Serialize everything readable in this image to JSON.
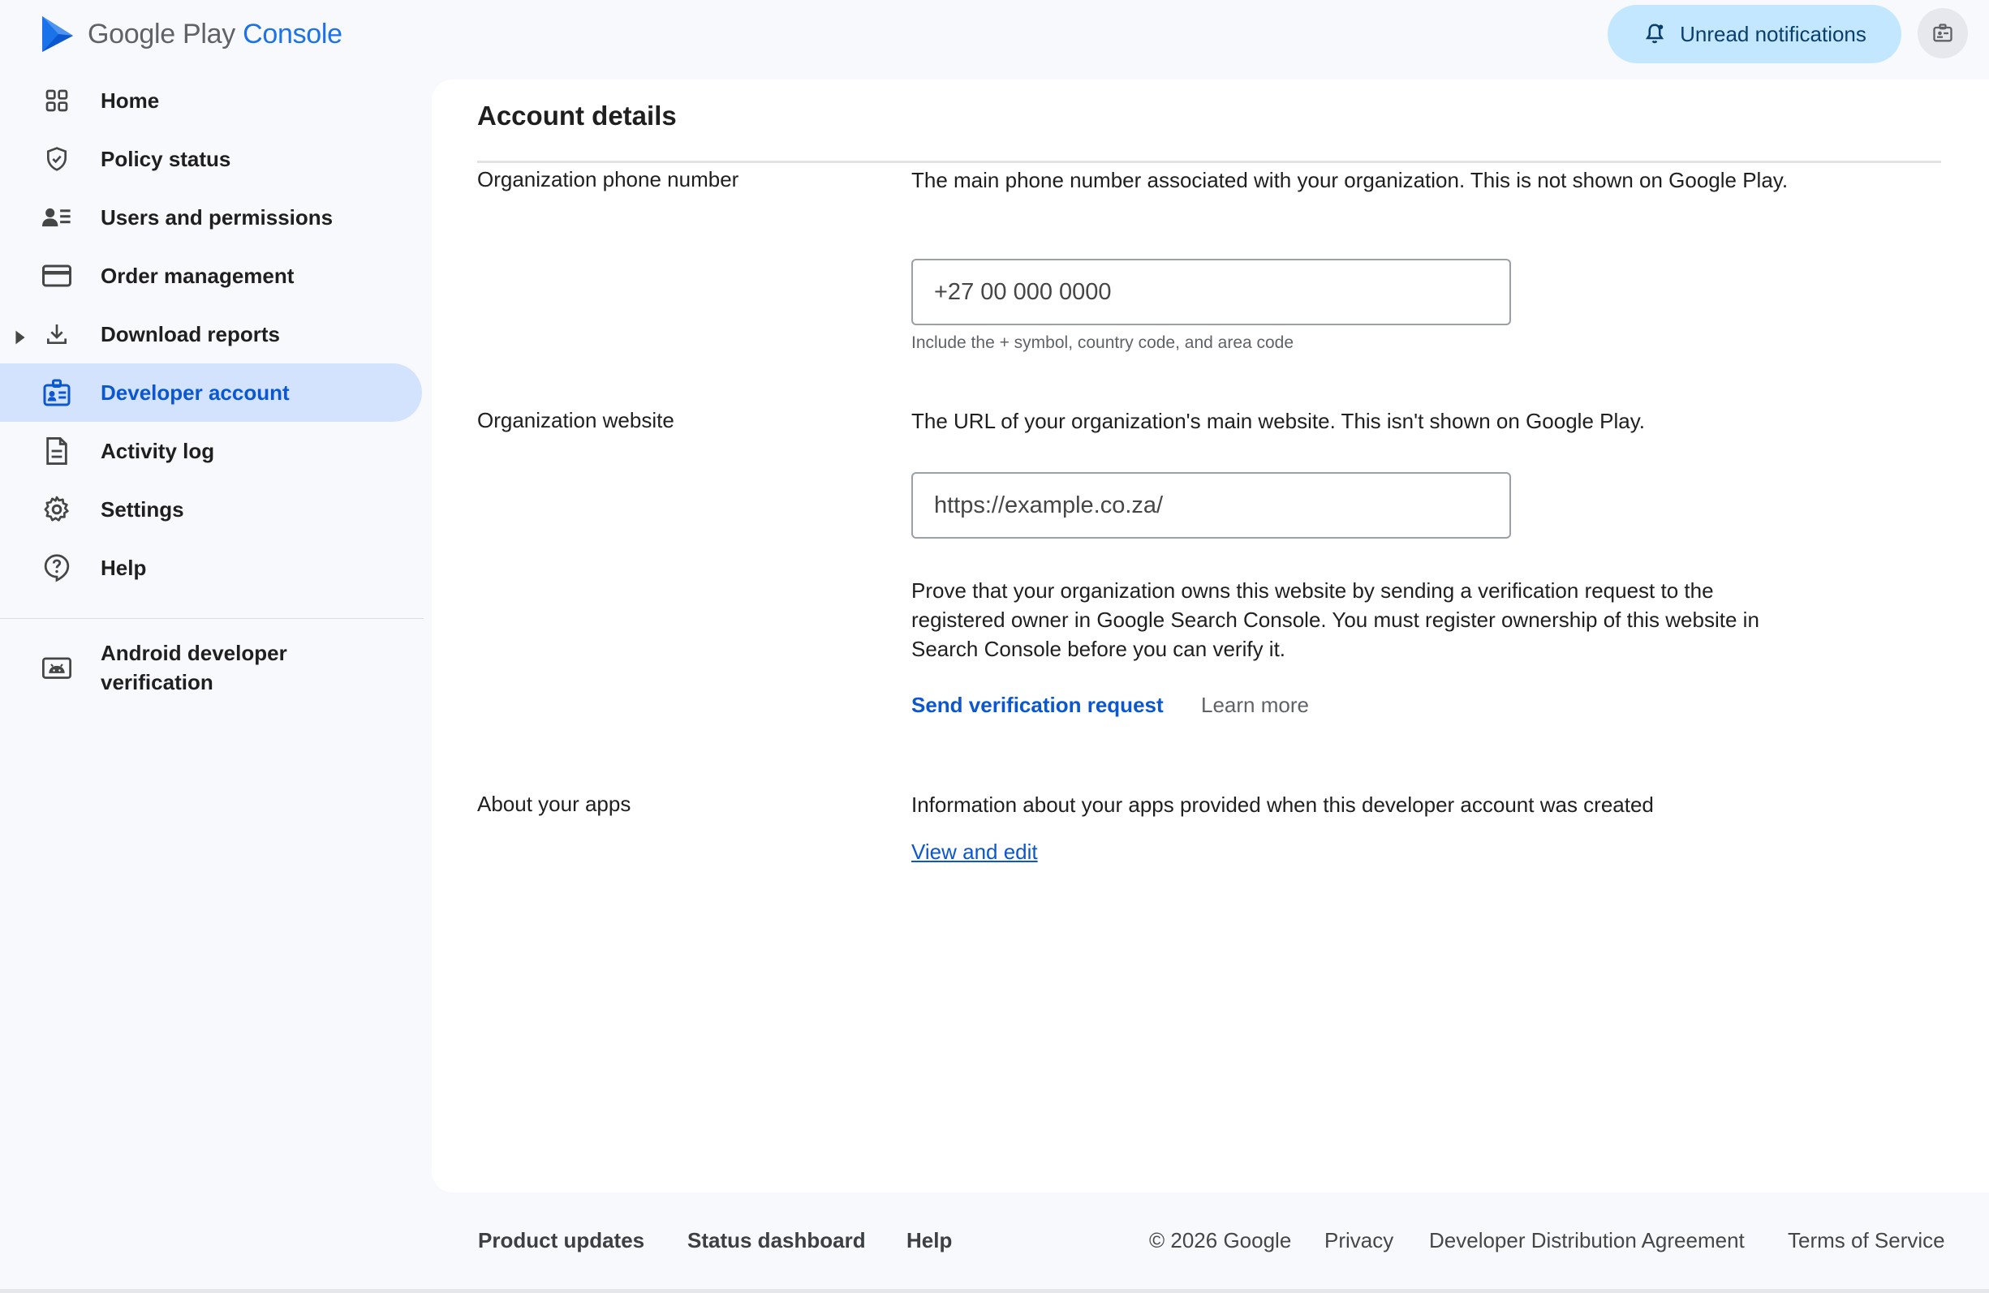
{
  "app": {
    "logo_name": "Google Play",
    "logo_accent": "Console",
    "notifications_label": "Unread notifications"
  },
  "sidebar": {
    "items": [
      {
        "label": "Home",
        "icon": "grid-icon"
      },
      {
        "label": "Policy status",
        "icon": "shield-icon"
      },
      {
        "label": "Users and permissions",
        "icon": "users-icon"
      },
      {
        "label": "Order management",
        "icon": "card-icon"
      },
      {
        "label": "Download reports",
        "icon": "download-icon"
      },
      {
        "label": "Developer account",
        "icon": "id-badge-icon",
        "active": true
      },
      {
        "label": "Activity log",
        "icon": "document-icon"
      },
      {
        "label": "Settings",
        "icon": "gear-icon"
      },
      {
        "label": "Help",
        "icon": "help-icon"
      }
    ],
    "extra_item": {
      "label": "Android developer verification",
      "icon": "android-icon"
    }
  },
  "main": {
    "title": "Account details",
    "phone": {
      "label": "Organization phone number",
      "description": "The main phone number associated with your organization. This is not shown on Google Play.",
      "value": "+27 00 000 0000",
      "hint": "Include the + symbol, country code, and area code"
    },
    "website": {
      "label": "Organization website",
      "description": "The URL of your organization's main website. This isn't shown on Google Play.",
      "value": "https://example.co.za/",
      "verify_text": "Prove that your organization owns this website by sending a verification request to the registered owner in Google Search Console. You must register ownership of this website in Search Console before you can verify it.",
      "send_label": "Send verification request",
      "learn_label": "Learn more"
    },
    "apps": {
      "label": "About your apps",
      "description": "Information about your apps provided when this developer account was created",
      "link_label": "View and edit"
    }
  },
  "footer": {
    "product_updates": "Product updates",
    "status_dashboard": "Status dashboard",
    "help": "Help",
    "copyright": "© 2026 Google",
    "privacy": "Privacy",
    "dda": "Developer Distribution Agreement",
    "tos": "Terms of Service"
  },
  "colors": {
    "accent": "#0b57d0",
    "active_bg": "#d3e3fd",
    "notif_bg": "#c2e7ff",
    "background": "#f8f9fc"
  }
}
